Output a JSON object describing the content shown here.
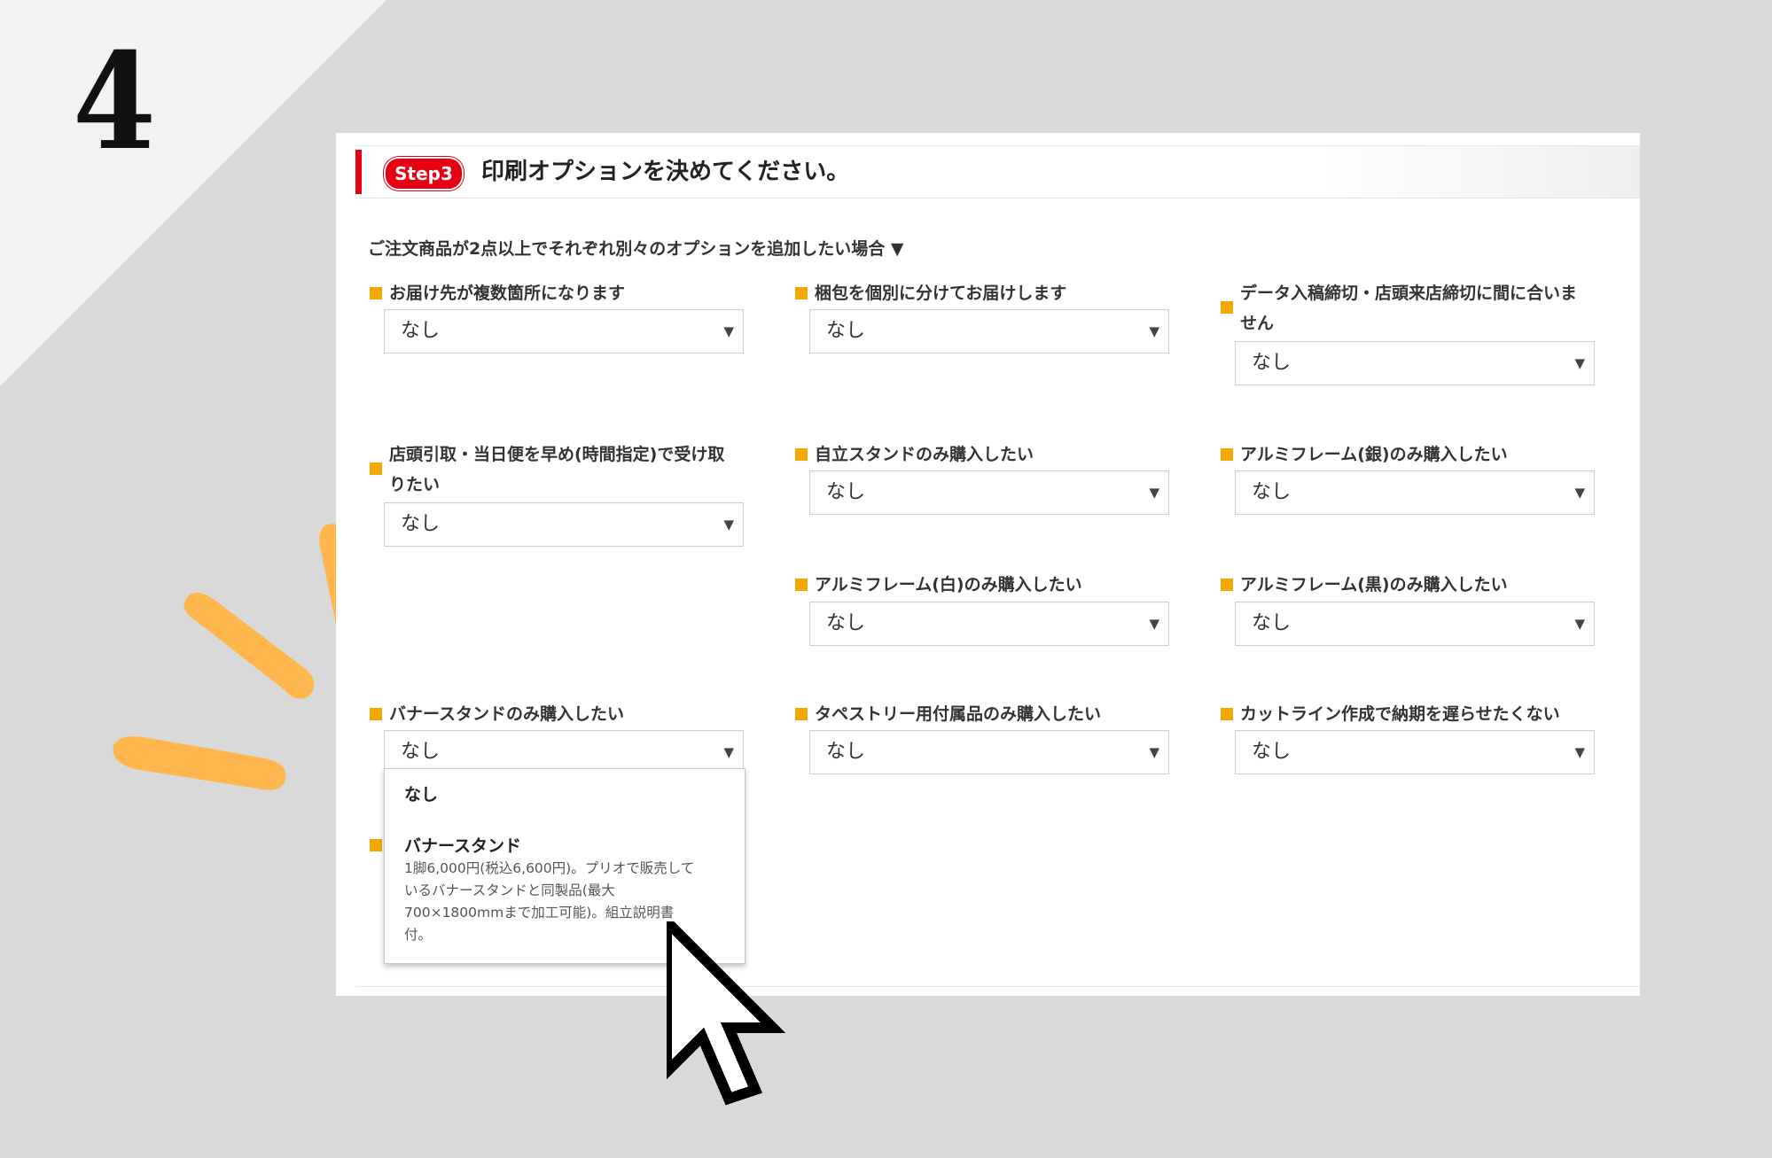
{
  "step_number": "4",
  "header": {
    "badge": "Step3",
    "title": "印刷オプションを決めてください。"
  },
  "note": "ご注文商品が2点以上でそれぞれ別々のオプションを追加したい場合 ▼",
  "options": [
    {
      "label": "お届け先が複数箇所になります",
      "value": "なし"
    },
    {
      "label": "梱包を個別に分けてお届けします",
      "value": "なし"
    },
    {
      "label_line1": "データ入稿締切・店頭来店締切に間に合いま",
      "label_line2": "せん",
      "value": "なし"
    },
    {
      "label_line1": "店頭引取・当日便を早め(時間指定)で受け取",
      "label_line2": "りたい",
      "value": "なし"
    },
    {
      "label": "自立スタンドのみ購入したい",
      "value": "なし"
    },
    {
      "label": "アルミフレーム(銀)のみ購入したい",
      "value": "なし"
    },
    {
      "label": "アルミフレーム(白)のみ購入したい",
      "value": "なし"
    },
    {
      "label": "アルミフレーム(黒)のみ購入したい",
      "value": "なし"
    },
    {
      "label": "バナースタンドのみ購入したい",
      "value": "なし"
    },
    {
      "label": "タペストリー用付属品のみ購入したい",
      "value": "なし"
    },
    {
      "label": "カットライン作成で納期を遅らせたくない",
      "value": "なし"
    }
  ],
  "dropdown": {
    "item1": "なし",
    "item2": "バナースタンド",
    "desc_line1": "1脚6,000円(税込6,600円)。プリオで販売して",
    "desc_line2": "いるバナースタンドと同製品(最大",
    "desc_line3": "700×1800mmまで加工可能)。組立説明書",
    "desc_line4": "付。"
  },
  "icons": {
    "arrow": "▼",
    "cursor": "mouse-pointer-icon"
  },
  "colors": {
    "accent_red": "#e60012",
    "bullet_orange": "#f5a800",
    "deco_orange": "#ffb74d"
  }
}
